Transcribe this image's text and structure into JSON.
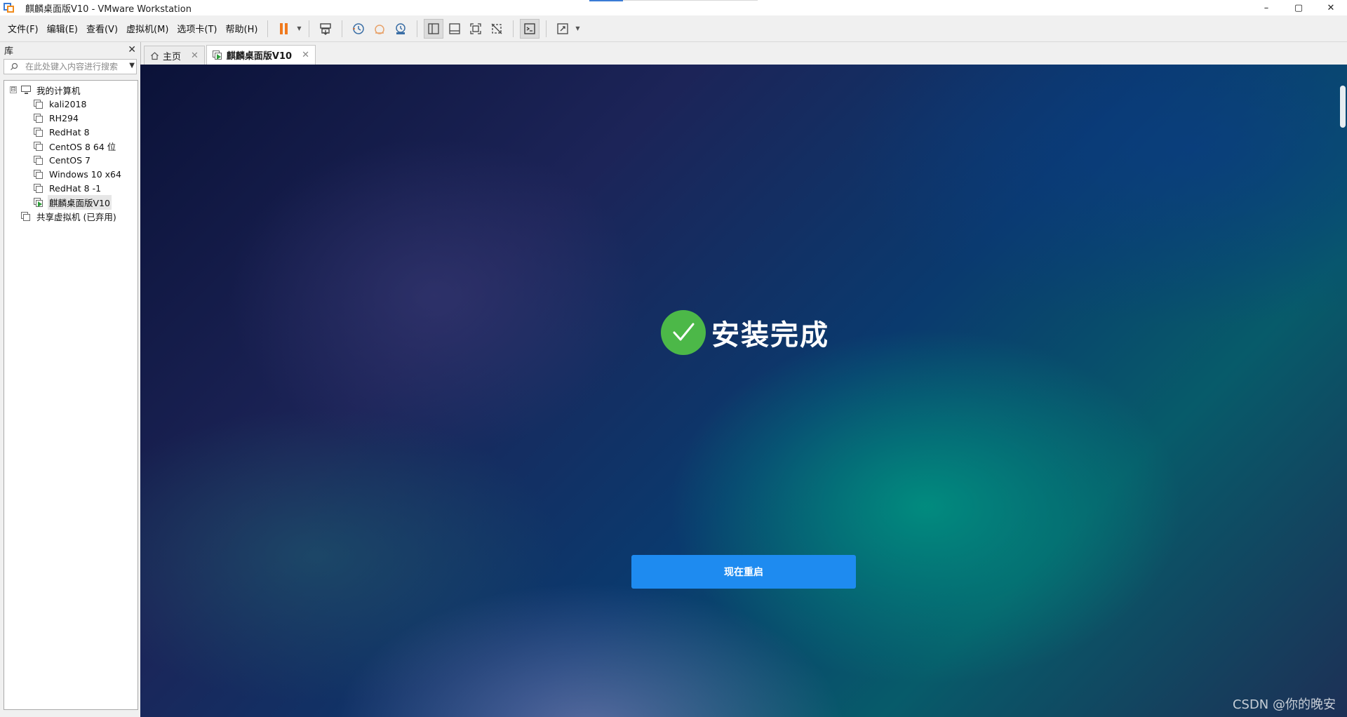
{
  "window": {
    "title": "麒麟桌面版V10 - VMware Workstation",
    "minimize": "–",
    "maximize": "▢",
    "close": "✕"
  },
  "menu": [
    "文件(F)",
    "编辑(E)",
    "查看(V)",
    "虚拟机(M)",
    "选项卡(T)",
    "帮助(H)"
  ],
  "library": {
    "title": "库",
    "close": "✕",
    "search_placeholder": "在此处键入内容进行搜索",
    "root": {
      "label": "我的计算机",
      "expander": "⊟"
    },
    "vms": [
      "kali2018",
      "RH294",
      "RedHat 8",
      "CentOS 8 64 位",
      "CentOS 7",
      "Windows 10 x64",
      "RedHat 8 -1",
      "麒麟桌面版V10"
    ],
    "selected_vm": "麒麟桌面版V10",
    "shared": "共享虚拟机 (已弃用)"
  },
  "tabs": [
    {
      "label": "主页",
      "close": "✕"
    },
    {
      "label": "麒麟桌面版V10",
      "close": "✕"
    }
  ],
  "guest": {
    "status_title": "安装完成",
    "reboot_label": "现在重启"
  },
  "watermark": "CSDN @你的晚安",
  "colors": {
    "pause": "#f07a1e",
    "success": "#4cb848",
    "primary_button": "#1e8bf0"
  }
}
